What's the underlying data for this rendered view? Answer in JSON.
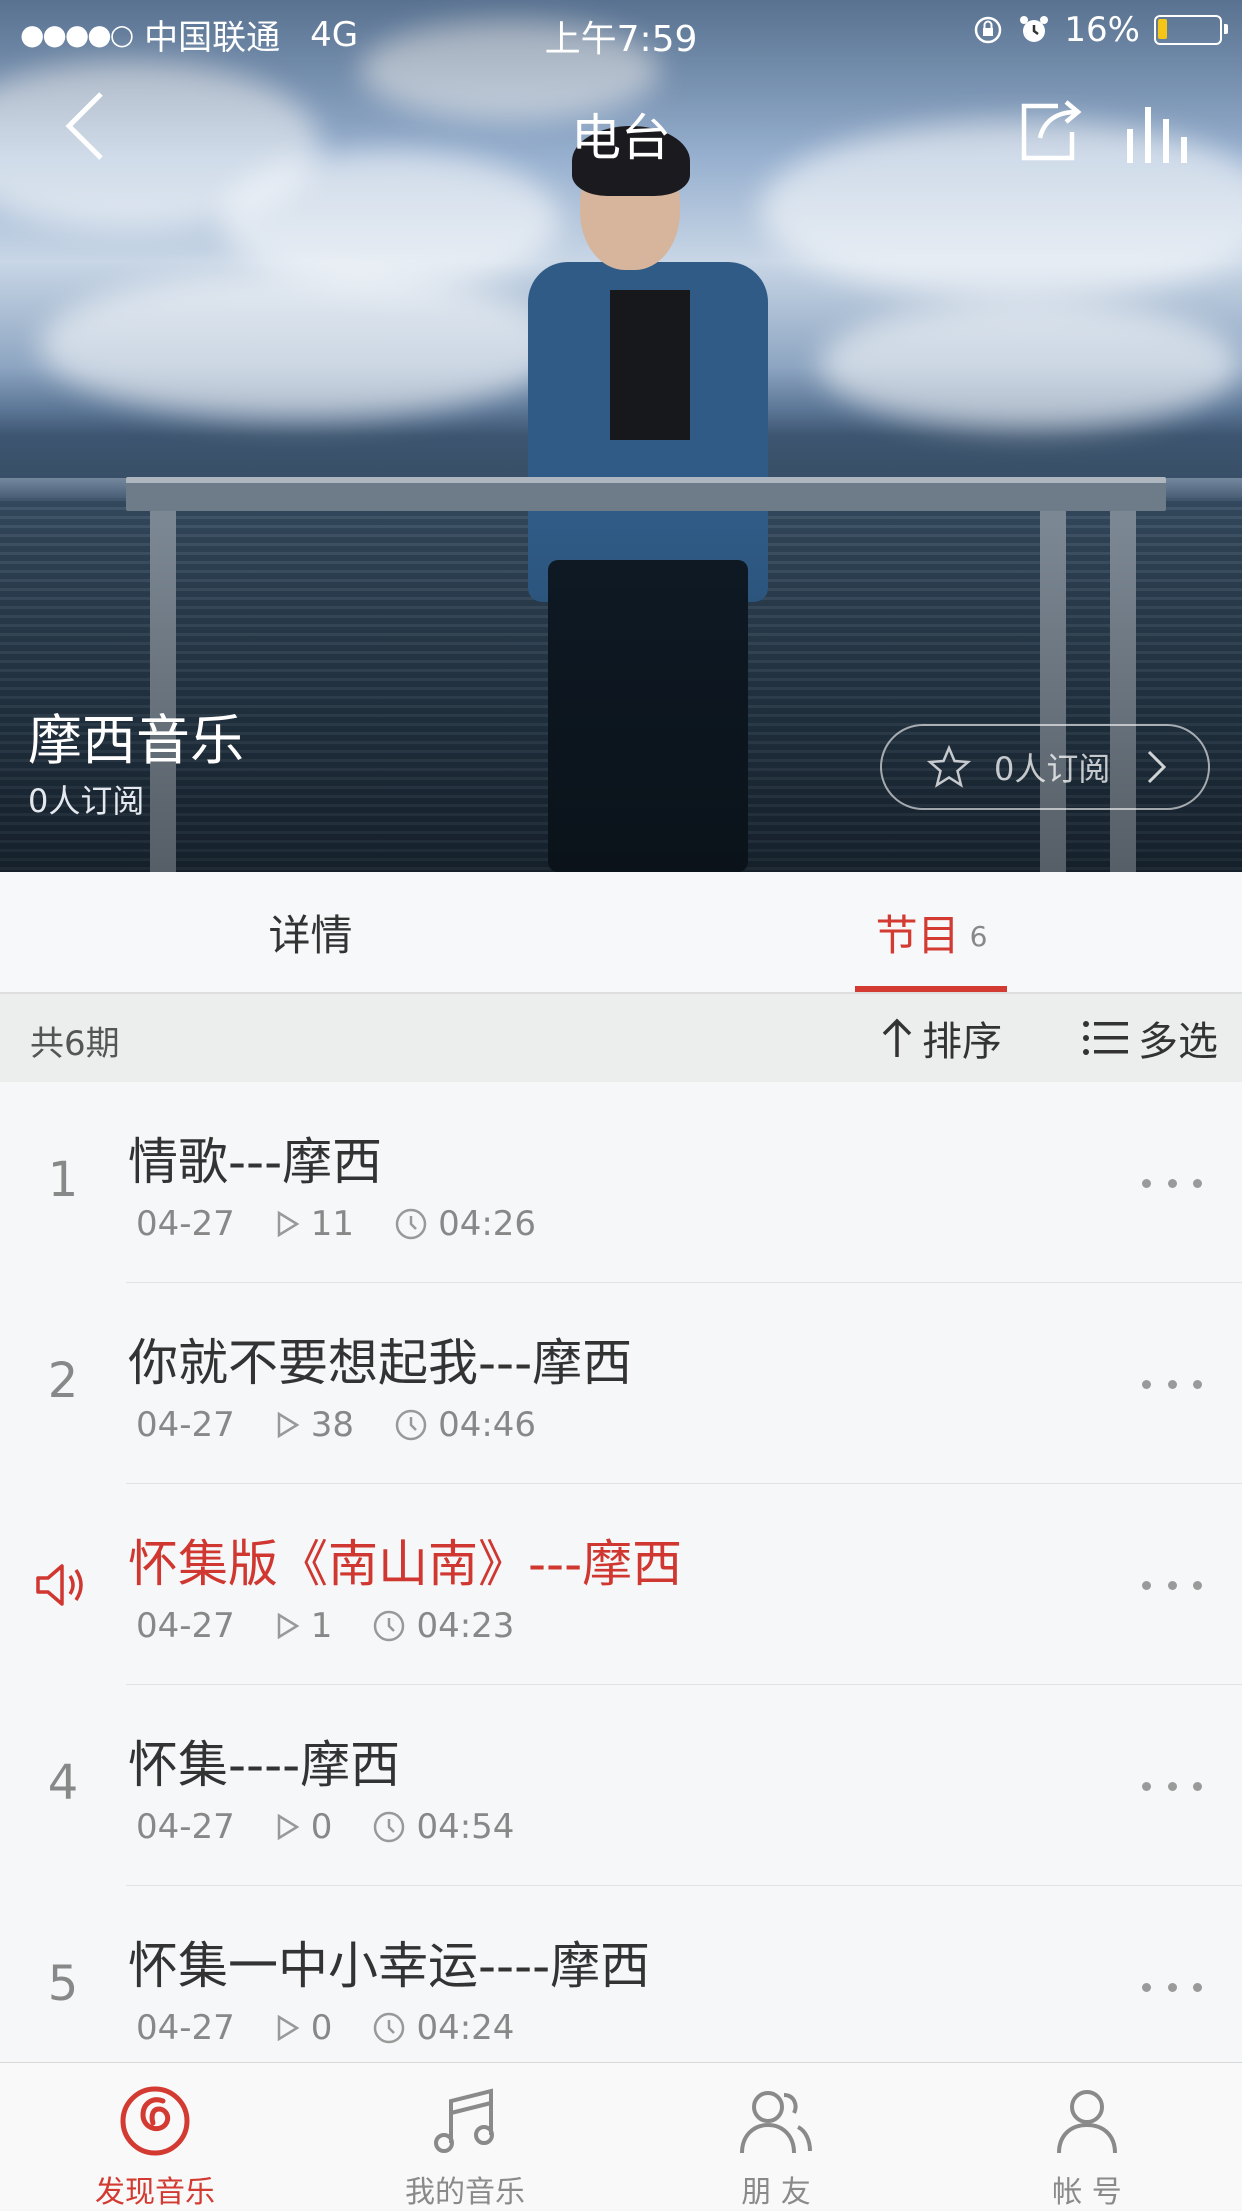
{
  "status_bar": {
    "carrier": "中国联通",
    "network": "4G",
    "time": "上午7:59",
    "battery": "16%",
    "battery_level": 0.16
  },
  "nav": {
    "title": "电台",
    "back_icon": "chevron-left-icon",
    "share_icon": "share-icon",
    "now_playing_icon": "equalizer-icon"
  },
  "radio": {
    "name": "摩西音乐",
    "subscribers": "0人订阅",
    "subscribe_button": "0人订阅"
  },
  "tabs": {
    "details": "详情",
    "programs": "节目",
    "programs_count": "6"
  },
  "list_header": {
    "total": "共6期",
    "sort": "排序",
    "multi_select": "多选"
  },
  "programs": [
    {
      "index": "1",
      "title": "情歌---摩西",
      "date": "04-27",
      "plays": "11",
      "duration": "04:26",
      "playing": false
    },
    {
      "index": "2",
      "title": "你就不要想起我---摩西",
      "date": "04-27",
      "plays": "38",
      "duration": "04:46",
      "playing": false
    },
    {
      "index": "3",
      "title": "怀集版《南山南》---摩西",
      "date": "04-27",
      "plays": "1",
      "duration": "04:23",
      "playing": true
    },
    {
      "index": "4",
      "title": "怀集----摩西",
      "date": "04-27",
      "plays": "0",
      "duration": "04:54",
      "playing": false
    },
    {
      "index": "5",
      "title": "怀集一中小幸运----摩西",
      "date": "04-27",
      "plays": "0",
      "duration": "04:24",
      "playing": false
    }
  ],
  "tabbar": {
    "discover": "发现音乐",
    "my_music": "我的音乐",
    "friends": "朋 友",
    "account": "帐 号"
  },
  "colors": {
    "accent": "#d33a31",
    "text": "#333333",
    "muted": "#888888"
  }
}
